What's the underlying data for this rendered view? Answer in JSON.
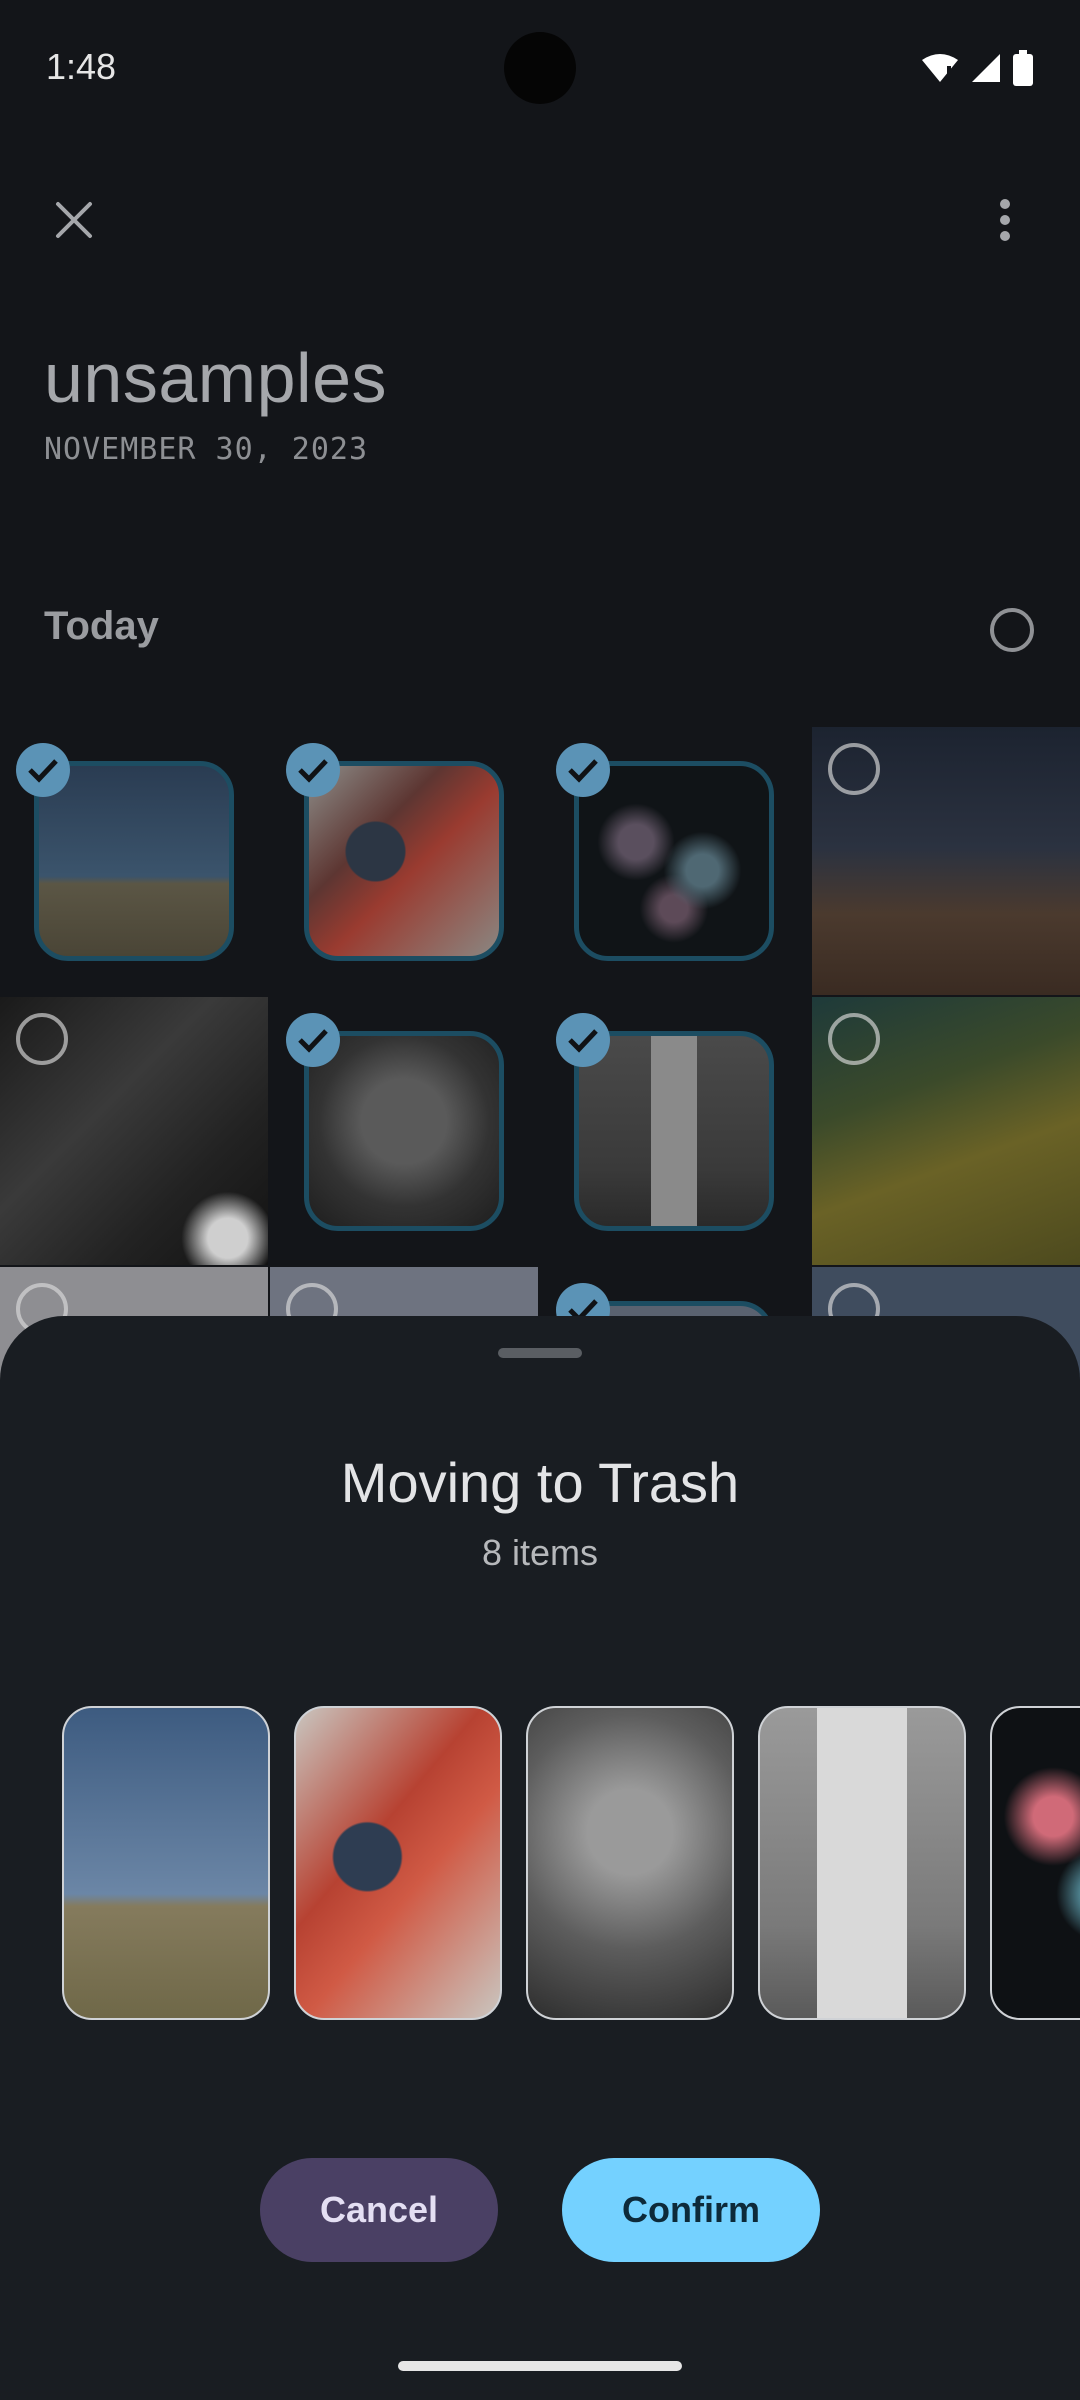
{
  "status_bar": {
    "time": "1:48"
  },
  "album": {
    "title": "unsamples",
    "date": "NOVEMBER 30, 2023",
    "section_label": "Today"
  },
  "grid_items": [
    {
      "name": "sky-field",
      "selected": true
    },
    {
      "name": "padlocks",
      "selected": true
    },
    {
      "name": "fireworks",
      "selected": true
    },
    {
      "name": "desert-night",
      "selected": false
    },
    {
      "name": "band-concert",
      "selected": false
    },
    {
      "name": "foggy-tree",
      "selected": true
    },
    {
      "name": "lighthouse",
      "selected": true
    },
    {
      "name": "mossy-trunk",
      "selected": false
    }
  ],
  "sheet": {
    "title": "Moving to Trash",
    "subtitle": "8 items",
    "cancel_label": "Cancel",
    "confirm_label": "Confirm"
  },
  "colors": {
    "accent": "#74d1ff",
    "check": "#5b93b6",
    "cancel_bg": "#4a4064",
    "sheet_bg": "#191d22"
  }
}
